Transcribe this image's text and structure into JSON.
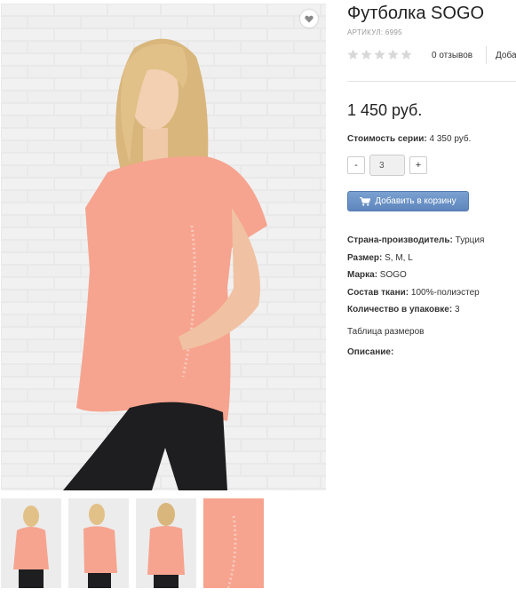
{
  "product": {
    "title": "Футболка SOGO",
    "sku": "АРТИКУЛ: 6995",
    "rating_stars": 0,
    "reviews": "0 отзывов",
    "add_review": "Доба",
    "price": "1 450 руб.",
    "series_label": "Стоимость серии:",
    "series_value": " 4 350 руб.",
    "quantity": "3",
    "minus": "-",
    "plus": "+",
    "add_to_cart": "Добавить в корзину",
    "size_table": "Таблица размеров",
    "description_label": "Описание:"
  },
  "properties": [
    {
      "label": "Страна-производитель:",
      "value": " Турция"
    },
    {
      "label": "Размер:",
      "value": " S, M, L"
    },
    {
      "label": "Марка:",
      "value": " SOGO"
    },
    {
      "label": "Состав ткани:",
      "value": " 100%-полиэстер"
    },
    {
      "label": "Количество в упаковке:",
      "value": " 3"
    }
  ],
  "colors": {
    "accent": "#6a90c6",
    "shirt": "#f6a48f",
    "jeans": "#1e1d1f",
    "star_empty": "#d8d8d8"
  },
  "icons": {
    "wishlist": "heart-icon",
    "cart": "cart-icon",
    "star": "star-icon"
  }
}
